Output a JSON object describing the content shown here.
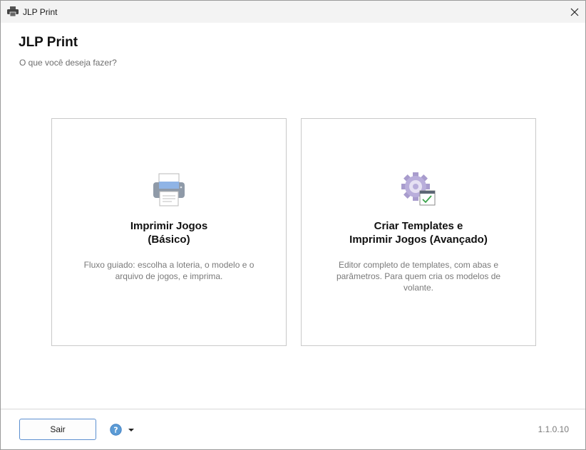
{
  "window": {
    "title": "JLP Print",
    "icon": "printer-icon",
    "close_icon": "close-icon"
  },
  "header": {
    "title": "JLP Print",
    "subtitle": "O que você deseja fazer?"
  },
  "cards": [
    {
      "icon": "printer-icon",
      "title_line1": "Imprimir Jogos",
      "title_line2": "(Básico)",
      "description": "Fluxo guiado: escolha a loteria, o modelo e o arquivo de jogos, e imprima."
    },
    {
      "icon": "gear-checklist-icon",
      "title_line1": "Criar Templates e",
      "title_line2": "Imprimir Jogos (Avançado)",
      "description": "Editor completo de templates, com abas e parâmetros. Para quem cria os modelos de volante."
    }
  ],
  "footer": {
    "exit_label": "Sair",
    "help_icon": "help-icon",
    "dropdown_icon": "chevron-down-icon",
    "version": "1.1.0.10"
  },
  "colors": {
    "titlebar_bg": "#f3f3f3",
    "accent_border": "#5b8fd0",
    "help_blue": "#5b9bd5",
    "muted_text": "#7a7a7a"
  }
}
